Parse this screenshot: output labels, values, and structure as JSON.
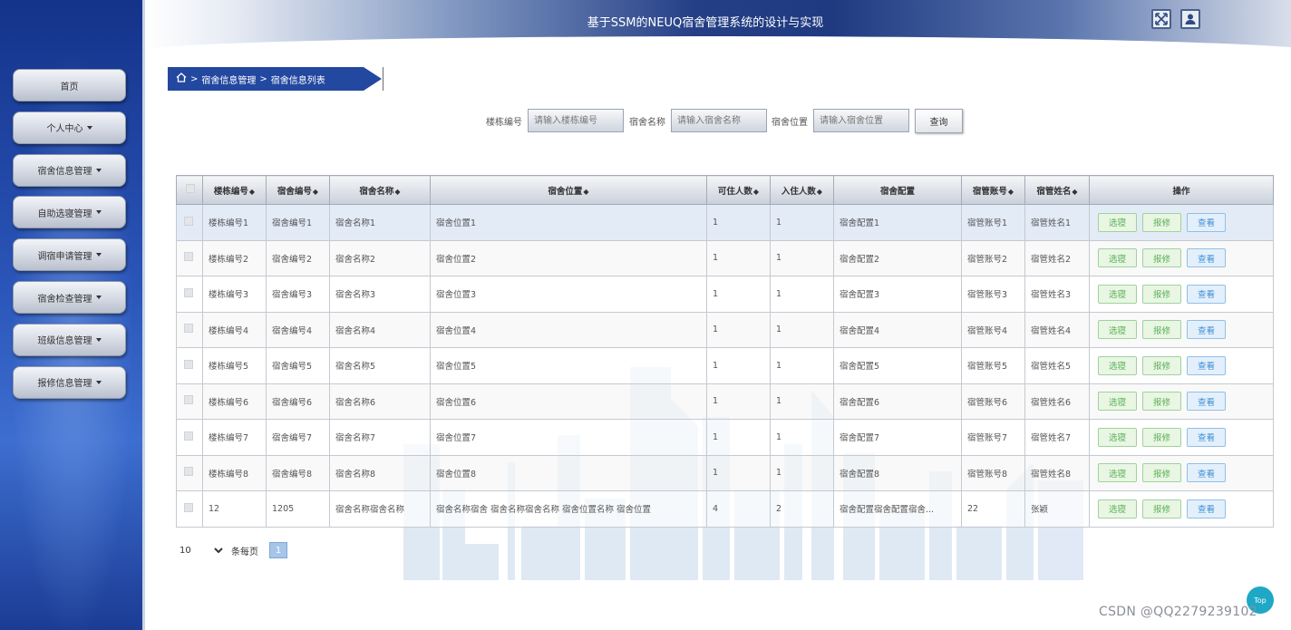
{
  "header": {
    "title": "基于SSM的NEUQ宿舍管理系统的设计与实现"
  },
  "sidebar": {
    "items": [
      {
        "label": "首页",
        "has_caret": false
      },
      {
        "label": "个人中心",
        "has_caret": true
      },
      {
        "label": "宿舍信息管理",
        "has_caret": true
      },
      {
        "label": "自助选寝管理",
        "has_caret": true
      },
      {
        "label": "调宿申请管理",
        "has_caret": true
      },
      {
        "label": "宿舍检查管理",
        "has_caret": true
      },
      {
        "label": "班级信息管理",
        "has_caret": true
      },
      {
        "label": "报修信息管理",
        "has_caret": true
      }
    ]
  },
  "breadcrumb": {
    "sep": ">",
    "items": [
      "宿舍信息管理",
      "宿舍信息列表"
    ]
  },
  "search": {
    "building_label": "楼栋编号",
    "building_placeholder": "请输入楼栋编号",
    "name_label": "宿舍名称",
    "name_placeholder": "请输入宿舍名称",
    "location_label": "宿舍位置",
    "location_placeholder": "请输入宿舍位置",
    "query_button": "查询"
  },
  "table": {
    "sort_icon": "◆",
    "columns": [
      {
        "label": "楼栋编号",
        "sortable": true
      },
      {
        "label": "宿舍编号",
        "sortable": true
      },
      {
        "label": "宿舍名称",
        "sortable": true
      },
      {
        "label": "宿舍位置",
        "sortable": true
      },
      {
        "label": "可住人数",
        "sortable": true
      },
      {
        "label": "入住人数",
        "sortable": true
      },
      {
        "label": "宿舍配置",
        "sortable": false
      },
      {
        "label": "宿管账号",
        "sortable": true
      },
      {
        "label": "宿管姓名",
        "sortable": true
      },
      {
        "label": "操作",
        "sortable": false
      }
    ],
    "actions": [
      "选寝",
      "报修",
      "查看"
    ],
    "rows": [
      [
        "楼栋编号1",
        "宿舍编号1",
        "宿舍名称1",
        "宿舍位置1",
        "1",
        "1",
        "宿舍配置1",
        "宿管账号1",
        "宿管姓名1"
      ],
      [
        "楼栋编号2",
        "宿舍编号2",
        "宿舍名称2",
        "宿舍位置2",
        "1",
        "1",
        "宿舍配置2",
        "宿管账号2",
        "宿管姓名2"
      ],
      [
        "楼栋编号3",
        "宿舍编号3",
        "宿舍名称3",
        "宿舍位置3",
        "1",
        "1",
        "宿舍配置3",
        "宿管账号3",
        "宿管姓名3"
      ],
      [
        "楼栋编号4",
        "宿舍编号4",
        "宿舍名称4",
        "宿舍位置4",
        "1",
        "1",
        "宿舍配置4",
        "宿管账号4",
        "宿管姓名4"
      ],
      [
        "楼栋编号5",
        "宿舍编号5",
        "宿舍名称5",
        "宿舍位置5",
        "1",
        "1",
        "宿舍配置5",
        "宿管账号5",
        "宿管姓名5"
      ],
      [
        "楼栋编号6",
        "宿舍编号6",
        "宿舍名称6",
        "宿舍位置6",
        "1",
        "1",
        "宿舍配置6",
        "宿管账号6",
        "宿管姓名6"
      ],
      [
        "楼栋编号7",
        "宿舍编号7",
        "宿舍名称7",
        "宿舍位置7",
        "1",
        "1",
        "宿舍配置7",
        "宿管账号7",
        "宿管姓名7"
      ],
      [
        "楼栋编号8",
        "宿舍编号8",
        "宿舍名称8",
        "宿舍位置8",
        "1",
        "1",
        "宿舍配置8",
        "宿管账号8",
        "宿管姓名8"
      ],
      [
        "12",
        "1205",
        "宿舍名称宿舍名称",
        "宿舍名称宿舍 宿舍名称宿舍名称 宿舍位置名称 宿舍位置",
        "4",
        "2",
        "宿舍配置宿舍配置宿舍...",
        "22",
        "张颖"
      ]
    ]
  },
  "pagination": {
    "page_size": "10",
    "per_page_label": "条每页",
    "current_page": "1"
  },
  "top_button": "Top",
  "watermark": "CSDN @QQ2279239102",
  "colors": {
    "sidebar": "#2a55b8",
    "header": "#243f86",
    "action_green": "#5bb056",
    "action_blue": "#3f8fd6",
    "top_button": "#1ea8c6"
  }
}
